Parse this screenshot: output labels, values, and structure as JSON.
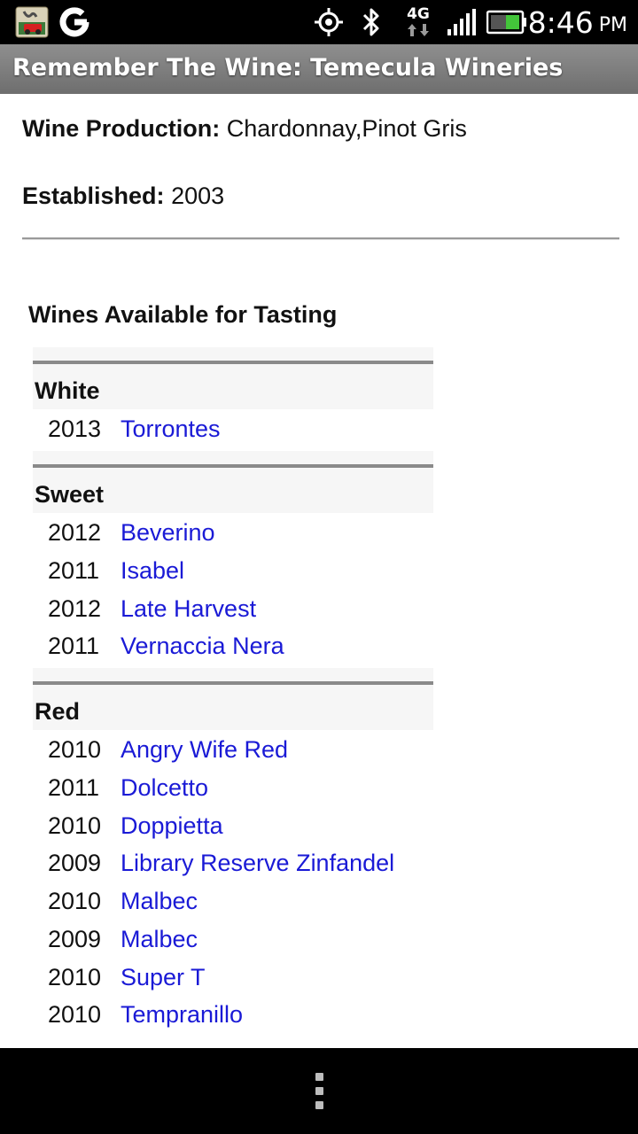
{
  "status_bar": {
    "time": "8:46",
    "ampm": "PM",
    "network_label": "4G",
    "icons": [
      "photo-notification-icon",
      "google-icon",
      "gps-icon",
      "bluetooth-icon",
      "4g-data-icon",
      "signal-strength-icon",
      "battery-icon"
    ]
  },
  "title_bar": {
    "title": "Remember The Wine: Temecula Wineries"
  },
  "winery": {
    "production_label": "Wine Production:",
    "production_value": "Chardonnay,Pinot Gris",
    "established_label": "Established:",
    "established_value": "2003"
  },
  "tasting": {
    "title": "Wines Available for Tasting",
    "categories": [
      {
        "name": "White",
        "wines": [
          {
            "year": "2013",
            "name": "Torrontes"
          }
        ]
      },
      {
        "name": "Sweet",
        "wines": [
          {
            "year": "2012",
            "name": "Beverino"
          },
          {
            "year": "2011",
            "name": "Isabel"
          },
          {
            "year": "2012",
            "name": "Late Harvest"
          },
          {
            "year": "2011",
            "name": "Vernaccia Nera"
          }
        ]
      },
      {
        "name": "Red",
        "wines": [
          {
            "year": "2010",
            "name": "Angry Wife Red"
          },
          {
            "year": "2011",
            "name": "Dolcetto"
          },
          {
            "year": "2010",
            "name": "Doppietta"
          },
          {
            "year": "2009",
            "name": "Library Reserve Zinfandel"
          },
          {
            "year": "2010",
            "name": "Malbec"
          },
          {
            "year": "2009",
            "name": "Malbec"
          },
          {
            "year": "2010",
            "name": "Super T"
          },
          {
            "year": "2010",
            "name": "Tempranillo"
          }
        ]
      }
    ]
  },
  "colors": {
    "link": "#1a1ad6",
    "title_bar": "#7d7d7d",
    "category_bg": "#f6f6f6"
  }
}
